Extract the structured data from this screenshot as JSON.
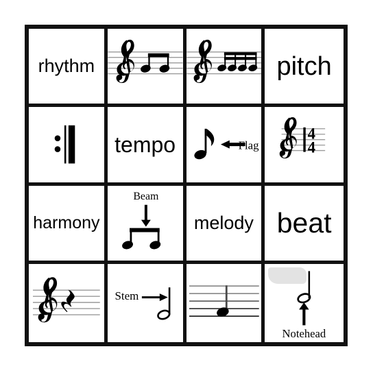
{
  "page": {
    "title": "Music Vocabulary Bingo Card",
    "background_color": "#ffffff",
    "grid_border_color": "#111111",
    "grid_rows": 4,
    "grid_cols": 4
  },
  "grid": {
    "cells": [
      {
        "row": 1,
        "col": 1,
        "kind": "word",
        "text": "rhythm",
        "name": "cell-rhythm"
      },
      {
        "row": 1,
        "col": 2,
        "kind": "notation",
        "text": "",
        "icon": "treble-clef-two-beamed-eighth-notes",
        "description": "Treble clef staff with two beamed eighth notes",
        "name": "cell-two-eighth-notes"
      },
      {
        "row": 1,
        "col": 3,
        "kind": "notation",
        "text": "",
        "icon": "treble-clef-four-beamed-sixteenth-notes",
        "description": "Treble clef staff with four beamed sixteenth notes",
        "name": "cell-four-sixteenth-notes"
      },
      {
        "row": 1,
        "col": 4,
        "kind": "word",
        "text": "pitch",
        "name": "cell-pitch"
      },
      {
        "row": 2,
        "col": 1,
        "kind": "notation",
        "text": "",
        "icon": "repeat-barline",
        "description": "End repeat sign: two dots and thin-thick barline",
        "name": "cell-repeat-sign"
      },
      {
        "row": 2,
        "col": 2,
        "kind": "word",
        "text": "tempo",
        "name": "cell-tempo"
      },
      {
        "row": 2,
        "col": 3,
        "kind": "labeled-notation",
        "text": "Flag",
        "icon": "eighth-note-with-flag-arrow-left",
        "description": "Eighth note with a left-pointing arrow labeled Flag",
        "name": "cell-flag"
      },
      {
        "row": 2,
        "col": 4,
        "kind": "notation",
        "text": "",
        "icon": "treble-clef-four-four-time-signature",
        "description": "Treble clef with 4/4 time signature",
        "name": "cell-time-signature"
      },
      {
        "row": 3,
        "col": 1,
        "kind": "word",
        "text": "harmony",
        "name": "cell-harmony"
      },
      {
        "row": 3,
        "col": 2,
        "kind": "labeled-notation",
        "text": "Beam",
        "icon": "beamed-eighth-notes-with-down-arrow",
        "description": "Two beamed eighth notes with a downward arrow labeled Beam",
        "name": "cell-beam"
      },
      {
        "row": 3,
        "col": 3,
        "kind": "word",
        "text": "melody",
        "name": "cell-melody"
      },
      {
        "row": 3,
        "col": 4,
        "kind": "word",
        "text": "beat",
        "name": "cell-beat"
      },
      {
        "row": 4,
        "col": 1,
        "kind": "notation",
        "text": "",
        "icon": "treble-clef-quarter-rest",
        "description": "Treble clef staff with a quarter rest",
        "name": "cell-quarter-rest"
      },
      {
        "row": 4,
        "col": 2,
        "kind": "labeled-notation",
        "text": "Stem",
        "icon": "half-note-with-right-arrow",
        "description": "Half note with a right-pointing arrow labeled Stem",
        "name": "cell-stem"
      },
      {
        "row": 4,
        "col": 3,
        "kind": "notation",
        "text": "",
        "icon": "staff-with-single-quarter-note",
        "description": "Staff with a single quarter note on the bottom space",
        "name": "cell-single-note"
      },
      {
        "row": 4,
        "col": 4,
        "kind": "labeled-notation",
        "text": "Notehead",
        "icon": "half-note-with-up-arrow",
        "description": "Half note with an upward arrow labeled Notehead",
        "name": "cell-notehead"
      }
    ]
  }
}
